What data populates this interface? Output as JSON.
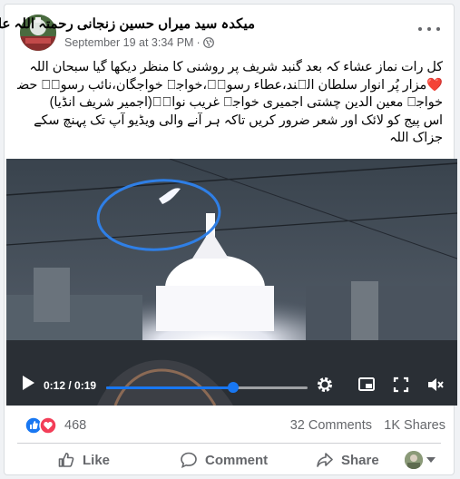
{
  "post": {
    "page_name": "میکدہ سید میراں حسین زنجانی رحمتہ اللہ علیہ",
    "timestamp": "September 19 at 3:34 PM",
    "separator": "·",
    "caption_lines": [
      "کل رات نماز عشاء کہ بعد گنبد شریف پر روشنی کا منظر دیکھا گیا سبحان اللہ",
      "❤️مزار پُر انوار سلطان الہند،عطاء رسولؐ،خواجہ خواجگان،نائب رسولؐ حضرت",
      "خواجہ معین الدین چشتی اجمیری خواجہ غریب نوازؒ(اجمیر شریف انڈیا)",
      "اس پیج کو لائک اور شعر ضرور کریں تاکہ ہر آنے والی ویڈیو آپ تک پہنچ سکے",
      "جزاک اللہ"
    ]
  },
  "video": {
    "current_time": "0:12",
    "duration": "0:19",
    "time_display": "0:12 / 0:19",
    "progress_fraction": 0.632
  },
  "engagement": {
    "reaction_count": "468",
    "comments": "32 Comments",
    "shares": "1K Shares"
  },
  "actions": {
    "like_label": "Like",
    "comment_label": "Comment",
    "share_label": "Share"
  },
  "colors": {
    "accent": "#1877f2",
    "love": "#f33e58",
    "circle_highlight": "#2f7fe6"
  },
  "icons": [
    "globe-icon",
    "more-icon",
    "play-icon",
    "settings-icon",
    "pip-icon",
    "fullscreen-icon",
    "volume-icon",
    "like-reaction-icon",
    "love-reaction-icon",
    "like-icon",
    "comment-icon",
    "share-icon"
  ]
}
